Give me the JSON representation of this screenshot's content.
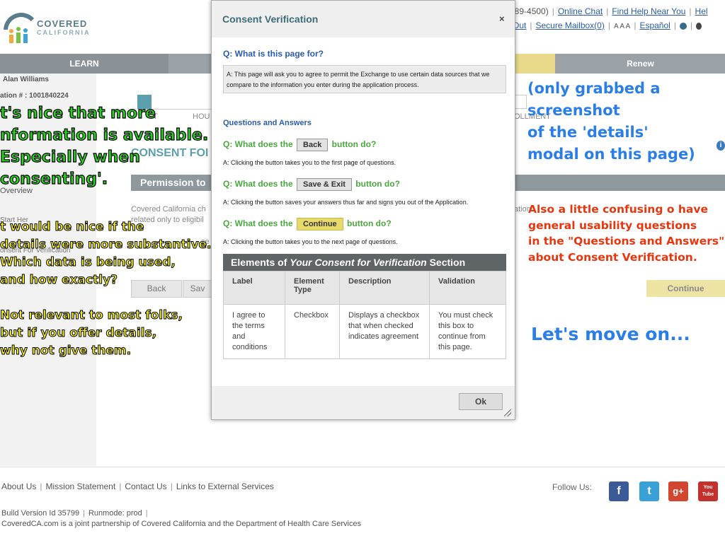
{
  "header": {
    "logo_top": "COVERED",
    "logo_bottom": "CALIFORNIA",
    "phone_fragment": "889-4500)",
    "links_row1": [
      "Online Chat",
      "Find Help Near You",
      "Hel"
    ],
    "links_row2_prefix": "Out",
    "links_row2": [
      "Secure Mailbox(0)",
      "Español"
    ],
    "text_size": "A A A"
  },
  "nav": {
    "learn": "LEARN",
    "renew": "Renew"
  },
  "sidebar": {
    "user_name": "Alan Williams",
    "application_fragment": "ation # : 1001840224",
    "overview": "Overview",
    "start_here": "Start Her",
    "consent": "onsent For Verification"
  },
  "background_page": {
    "tab_fragment_1": "T",
    "tab_fragment_2": "HOU",
    "tab_fragment_3": "OLLMENT",
    "section_title_fragment": "CONSENT FOI",
    "permission_fragment": "Permission to",
    "body_line1": "Covered California ch",
    "body_line2": "related only to eligibil",
    "body_fragment3": "se",
    "body_fragment4": "ation",
    "back_button": "Back",
    "save_fragment": "Sav",
    "continue_button": "Continue"
  },
  "modal": {
    "title": "Consent Verification",
    "close": "×",
    "q_page_for": "Q: What is this page for?",
    "a_page_for": "A: This page will ask you to agree to permit the Exchange to use certain data sources that we compare to the information you enter during the application process.",
    "qa_heading": "Questions and Answers",
    "q_back_pre": "Q: What does the",
    "q_back_btn": "Back",
    "q_back_post": "button do?",
    "a_back": "A: Clicking the button takes you to the first page of questions.",
    "q_save_pre": "Q: What does the",
    "q_save_btn": "Save & Exit",
    "q_save_post": "button do?",
    "a_save": "A: Clicking the button saves your answers thus far and signs you out of the Application.",
    "q_cont_pre": "Q: What does the",
    "q_cont_btn": "Continue",
    "q_cont_post": "button do?",
    "a_cont": "A: Clicking the button takes you to the next page of questions.",
    "table_title_pre": "Elements of ",
    "table_title_em": "Your Consent for Verification",
    "table_title_post": " Section",
    "table": {
      "headers": [
        "Label",
        "Element Type",
        "Description",
        "Validation"
      ],
      "rows": [
        [
          "I agree to the terms and conditions",
          "Checkbox",
          "Displays a checkbox that when checked indicates agreement",
          "You must check this box to continue from this page."
        ]
      ]
    },
    "ok_button": "Ok"
  },
  "footer": {
    "links": [
      "About Us",
      "Mission Statement",
      "Contact Us",
      "Links to External Services"
    ],
    "build": "Build Version Id 35799",
    "runmode": "Runmode: prod",
    "partnership": "CoveredCA.com is a joint partnership of Covered California and the Department of Health Care Services",
    "follow_us": "Follow Us:",
    "social": [
      "f",
      "t",
      "g+",
      "You Tube"
    ]
  },
  "annotations": {
    "green": [
      "t's nice that more",
      "nformation is available.",
      "Especially when",
      "consenting'."
    ],
    "yellow1": [
      "t would be nice if the",
      "details were more substantive.",
      "Which data is being used,",
      "and how exactly?"
    ],
    "yellow2": [
      "Not relevant to most folks,",
      "but if you offer details,",
      "why not give them."
    ],
    "blue1": [
      "(only grabbed a",
      "screenshot",
      "of the 'details'",
      "modal on this page)"
    ],
    "red": [
      "Also a little confusing o have",
      "general usability questions",
      "in the \"Questions and Answers\"",
      "about Consent Verification."
    ],
    "blue2": "Let's move on..."
  },
  "colors": {
    "nav_gray": "#9aa2a8",
    "modal_title": "#3b6e78",
    "question_blue": "#2a5bb0",
    "question_green": "#4aa83f",
    "continue_yellow": "#e8d96b",
    "annotation_green": "#2bd121",
    "annotation_yellow": "#f5ef1f",
    "annotation_blue": "#2b7ee8",
    "annotation_red": "#e8360f"
  }
}
